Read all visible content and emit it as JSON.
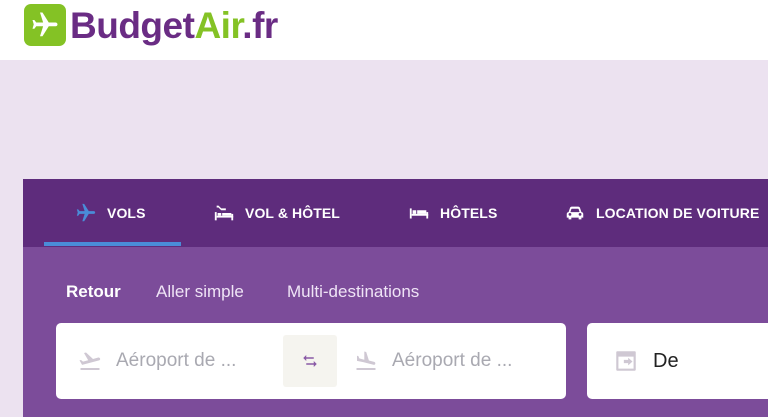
{
  "brand": {
    "name_part1": "Budget",
    "name_part2": "Air",
    "name_part3": ".fr",
    "color_primary": "#6a2c84",
    "color_accent": "#84c225"
  },
  "tabs": [
    {
      "label": "VOLS",
      "icon": "plane-icon",
      "active": true
    },
    {
      "label": "VOL & HÔTEL",
      "icon": "plane-bed-icon",
      "active": false
    },
    {
      "label": "HÔTELS",
      "icon": "bed-icon",
      "active": false
    },
    {
      "label": "LOCATION DE VOITURE",
      "icon": "car-icon",
      "active": false
    }
  ],
  "trip_types": [
    {
      "label": "Retour",
      "active": true
    },
    {
      "label": "Aller simple",
      "active": false
    },
    {
      "label": "Multi-destinations",
      "active": false
    }
  ],
  "search": {
    "origin_placeholder": "Aéroport de ...",
    "destination_placeholder": "Aéroport de ...",
    "date_label": "De"
  },
  "colors": {
    "background": "#ece2f0",
    "tabbar": "#5e2c7c",
    "panel": "#7c4c9a",
    "active_underline": "#4a8cd8"
  }
}
